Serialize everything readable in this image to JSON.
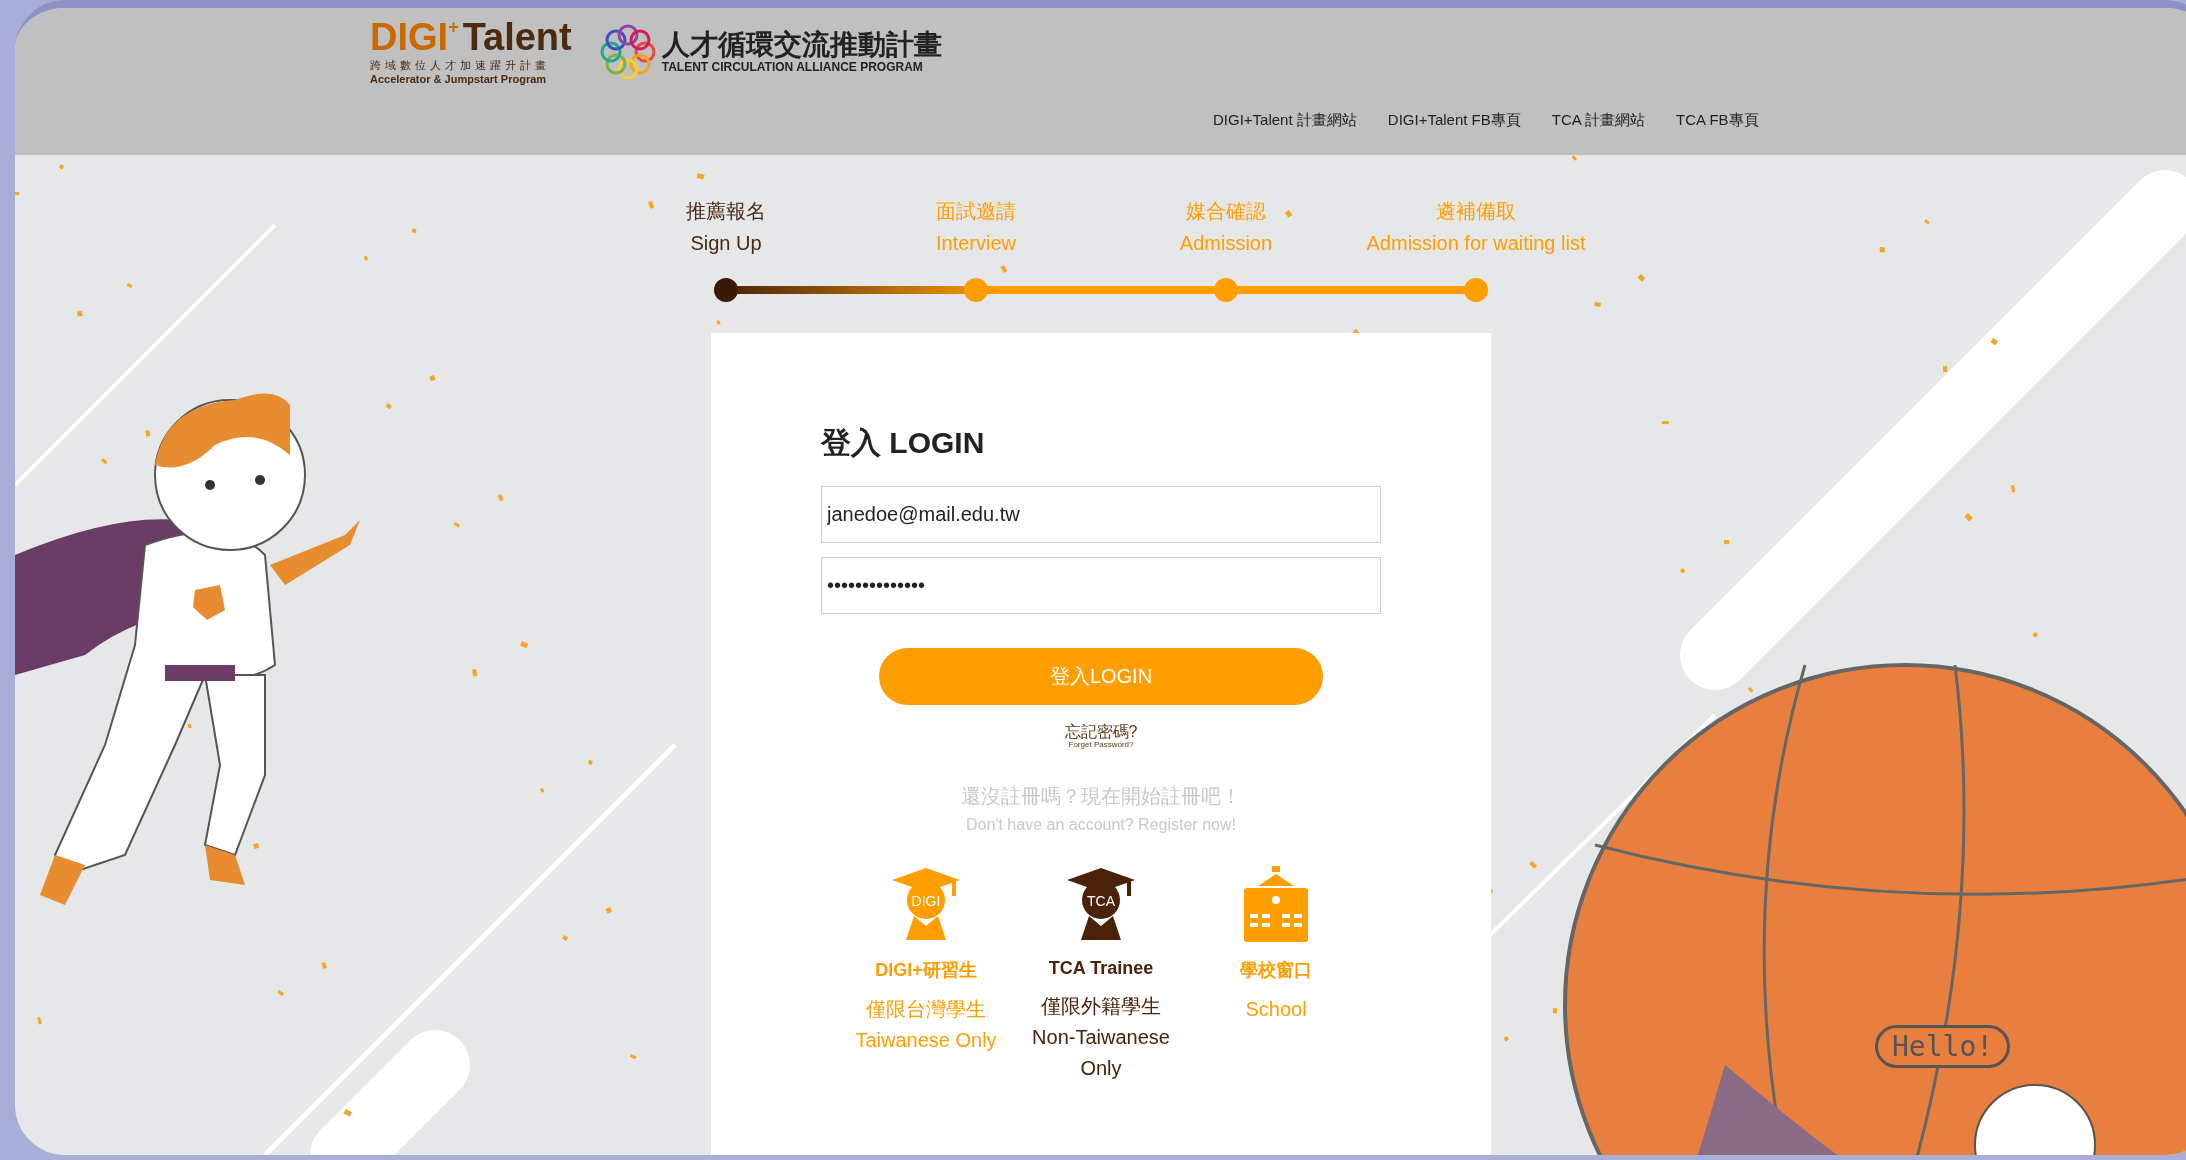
{
  "header": {
    "logo_main": "DIGI",
    "logo_sup": "+",
    "logo_word": "Talent",
    "logo_sub_zh": "跨域數位人才加速躍升計畫",
    "logo_sub_en": "Accelerator & Jumpstart Program",
    "tca_title": "人才循環交流推動計畫",
    "tca_sub": "TALENT CIRCULATION ALLIANCE PROGRAM"
  },
  "nav": [
    {
      "label": "DIGI+Talent 計畫網站"
    },
    {
      "label": "DIGI+Talent FB專頁"
    },
    {
      "label": "TCA 計畫網站"
    },
    {
      "label": "TCA FB專頁"
    }
  ],
  "steps": [
    {
      "zh": "推薦報名",
      "en": "Sign Up",
      "selected": true
    },
    {
      "zh": "面試邀請",
      "en": "Interview",
      "selected": false
    },
    {
      "zh": "媒合確認",
      "en": "Admission",
      "selected": false
    },
    {
      "zh": "遴補備取",
      "en": "Admission for waiting list",
      "selected": false
    }
  ],
  "login": {
    "title": "登入 LOGIN",
    "email": "janedoe@mail.edu.tw",
    "password": "••••••••••••••",
    "button": "登入LOGIN",
    "forgot_zh": "忘記密碼?",
    "forgot_en": "Forget Password?",
    "register_zh": "還沒註冊嗎？現在開始註冊吧！",
    "register_en": "Don't have an account? Register now!"
  },
  "roles": [
    {
      "kind": "digi",
      "badge": "DIGI",
      "title": "DIGI+研習生",
      "desc_zh": "僅限台灣學生",
      "desc_en": "Taiwanese Only",
      "color": "#ff9e00"
    },
    {
      "kind": "tca",
      "badge": "TCA",
      "title": "TCA Trainee",
      "desc_zh": "僅限外籍學生",
      "desc_en": "Non-Taiwanese Only",
      "color": "#4a2208"
    },
    {
      "kind": "school",
      "title": "學校窗口",
      "desc_en": "School",
      "color": "#ff9e00"
    }
  ],
  "globe": {
    "bubble_text": "Hello!"
  }
}
